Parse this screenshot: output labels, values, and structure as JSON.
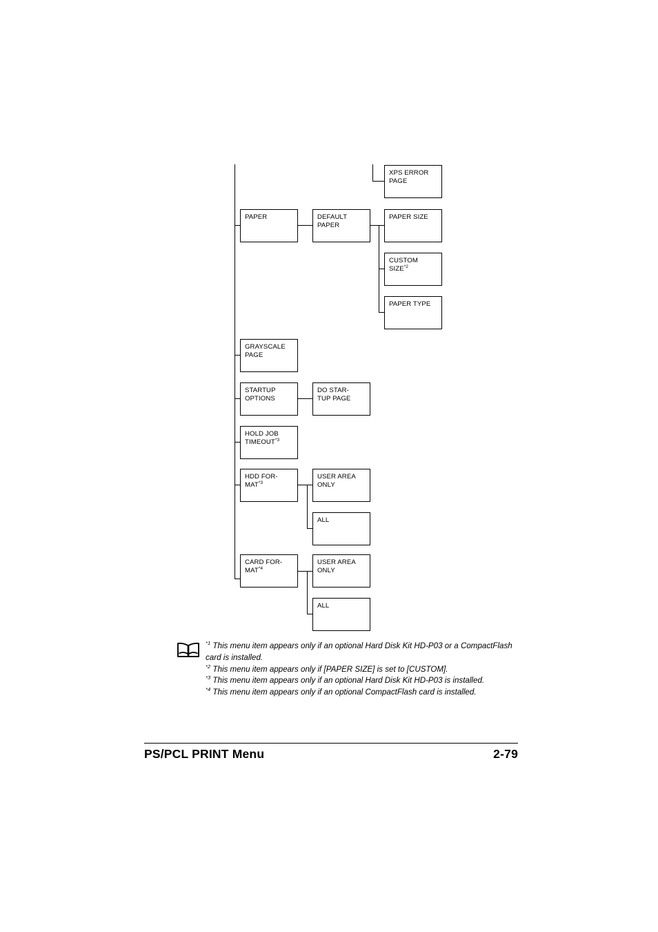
{
  "page": {
    "footer_title": "PS/PCL PRINT Menu",
    "page_number": "2-79",
    "book_icon": "open-book-icon"
  },
  "diagram": {
    "type": "menu-tree",
    "nodes": {
      "xps_error_page": "XPS ERROR\nPAGE",
      "paper": "PAPER",
      "default_paper": "DEFAULT\nPAPER",
      "paper_size": "PAPER SIZE",
      "custom_size": "CUSTOM\nSIZE",
      "custom_size_sup": "*2",
      "paper_type": "PAPER TYPE",
      "grayscale_page": "GRAYSCALE\nPAGE",
      "startup_options": "STARTUP\nOPTIONS",
      "do_startup_page": "DO STAR-\nTUP PAGE",
      "hold_job_timeout": "HOLD JOB\nTIMEOUT",
      "hold_job_timeout_sup": "*3",
      "hdd_format": "HDD FOR-\nMAT",
      "hdd_format_sup": "*3",
      "hdd_user_area_only": "USER AREA\nONLY",
      "hdd_all": "ALL",
      "card_format": "CARD FOR-\nMAT",
      "card_format_sup": "*4",
      "card_user_area_only": "USER AREA\nONLY",
      "card_all": "ALL"
    }
  },
  "footnotes": [
    {
      "marker": "*1",
      "text": " This menu item appears only if an optional Hard Disk Kit HD-P03 or a CompactFlash card is installed."
    },
    {
      "marker": "*2",
      "text": " This menu item appears only if [PAPER SIZE] is set to [CUSTOM]."
    },
    {
      "marker": "*3",
      "text": " This menu item appears only if an optional Hard Disk Kit HD-P03 is installed."
    },
    {
      "marker": "*4",
      "text": " This menu item appears only if an optional CompactFlash card is installed."
    }
  ]
}
